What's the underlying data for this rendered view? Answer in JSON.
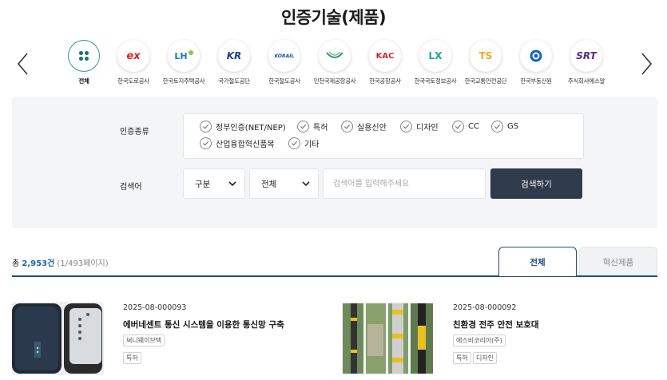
{
  "page": {
    "title": "인증기술(제품)"
  },
  "carousel": {
    "orgs": [
      {
        "label": "전체",
        "icon": "all-grid-icon",
        "active": true
      },
      {
        "label": "한국도로공사",
        "icon": "ex-logo-icon",
        "text": "ex"
      },
      {
        "label": "한국토지주택공사",
        "icon": "lh-logo-icon",
        "text": "LH"
      },
      {
        "label": "국가철도공단",
        "icon": "kr-logo-icon",
        "text": "KR"
      },
      {
        "label": "한국철도공사",
        "icon": "korail-logo-icon",
        "text": "KORAIL"
      },
      {
        "label": "인천국제공항공사",
        "icon": "airport-logo-icon",
        "text": ""
      },
      {
        "label": "한국공항공사",
        "icon": "kac-logo-icon",
        "text": "KAC"
      },
      {
        "label": "한국국토정보공사",
        "icon": "lx-logo-icon",
        "text": "LX"
      },
      {
        "label": "한국교통안전공단",
        "icon": "ts-logo-icon",
        "text": "TS"
      },
      {
        "label": "한국부동산원",
        "icon": "reb-logo-icon",
        "text": ""
      },
      {
        "label": "주식회사에스알",
        "icon": "srt-logo-icon",
        "text": "SRT"
      }
    ]
  },
  "filter": {
    "type_label": "인증종류",
    "types": [
      "정부인증(NET/NEP)",
      "특허",
      "실용신안",
      "디자인",
      "CC",
      "GS",
      "산업융합혁신품목",
      "기타"
    ],
    "search_label": "검색어",
    "select1": "구분",
    "select2": "전체",
    "search_placeholder": "검색어를 입력해주세요",
    "search_button": "검색하기"
  },
  "results": {
    "prefix": "총 ",
    "total": "2,953건",
    "pages": "(1/493페이지)",
    "tabs": [
      "전체",
      "혁신제품"
    ]
  },
  "items": [
    {
      "id": "2025-08-000093",
      "title": "에버네센트 통신 시스템을 이용한 통신망 구축",
      "company": "써니웨이브텍",
      "tags": [
        "특허"
      ]
    },
    {
      "id": "2025-08-000092",
      "title": "친환경 전주 안전 보호대",
      "company": "에스비코리아(주)",
      "tags": [
        "특허",
        "디자인"
      ]
    }
  ],
  "colors": {
    "accent": "#1f4d7a",
    "button": "#2f3a4b",
    "count": "#1f5fa8",
    "active_ring": "#2a9d8f"
  }
}
